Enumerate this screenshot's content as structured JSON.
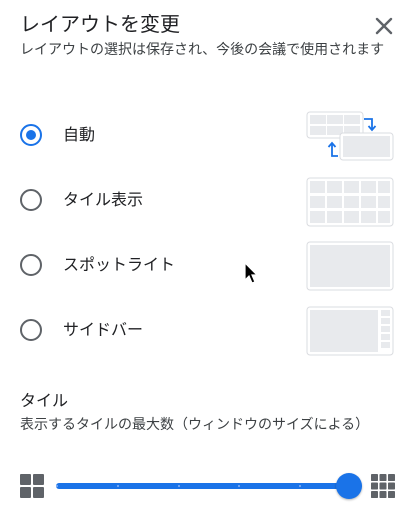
{
  "dialog": {
    "title": "レイアウトを変更",
    "subtitle": "レイアウトの選択は保存され、今後の会議で使用されます"
  },
  "layouts": {
    "selected": "auto",
    "options": [
      {
        "id": "auto",
        "label": "自動",
        "icon": "layout-auto-icon"
      },
      {
        "id": "tiled",
        "label": "タイル表示",
        "icon": "layout-tiled-icon"
      },
      {
        "id": "spotlight",
        "label": "スポットライト",
        "icon": "layout-spotlight-icon"
      },
      {
        "id": "sidebar",
        "label": "サイドバー",
        "icon": "layout-sidebar-icon"
      }
    ]
  },
  "tiles": {
    "title": "タイル",
    "description": "表示するタイルの最大数（ウィンドウのサイズによる）",
    "slider_value_fraction": 1.0,
    "slider_steps": 6,
    "min_icon": "grid-small-icon",
    "max_icon": "grid-large-icon"
  },
  "colors": {
    "accent": "#1a73e8",
    "text": "#202124",
    "secondary_text": "#3c4043",
    "thumb_border": "#dadce0",
    "thumb_fill": "#e8eaed"
  }
}
